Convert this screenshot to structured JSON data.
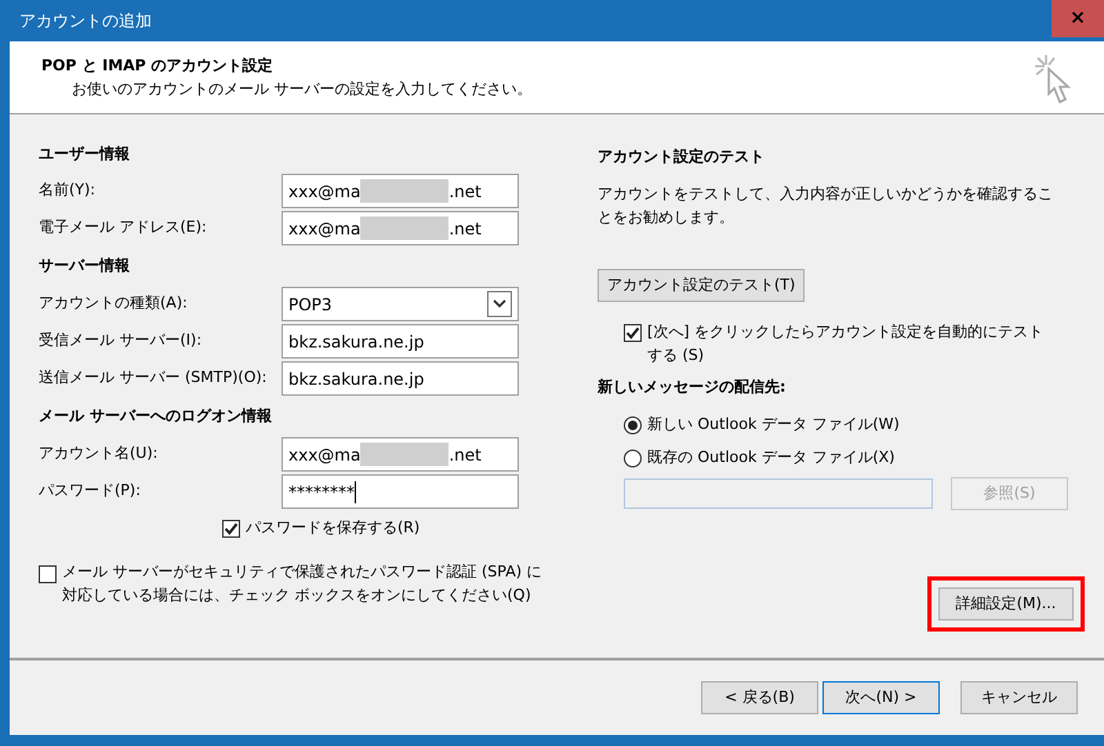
{
  "window": {
    "title": "アカウントの追加",
    "close": "×"
  },
  "header": {
    "title": "POP と IMAP のアカウント設定",
    "subtitle": "お使いのアカウントのメール サーバーの設定を入力してください。"
  },
  "left_sections": [
    {
      "heading": "ユーザー情報",
      "fields": [
        {
          "kind": "text",
          "label": "名前(Y):",
          "value": "xxx@ma",
          "value_suffix": ".net",
          "redacted": true
        },
        {
          "kind": "text",
          "label": "電子メール アドレス(E):",
          "value": "xxx@ma",
          "value_suffix": ".net",
          "redacted": true
        }
      ]
    },
    {
      "heading": "サーバー情報",
      "fields": [
        {
          "kind": "select",
          "label": "アカウントの種類(A):",
          "value": "POP3"
        },
        {
          "kind": "text",
          "label": "受信メール サーバー(I):",
          "value": "bkz.sakura.ne.jp",
          "redacted": false
        },
        {
          "kind": "text",
          "label": "送信メール サーバー (SMTP)(O):",
          "value": "bkz.sakura.ne.jp",
          "redacted": false
        }
      ]
    },
    {
      "heading": "メール サーバーへのログオン情報",
      "fields": [
        {
          "kind": "text",
          "label": "アカウント名(U):",
          "value": "xxx@ma",
          "value_suffix": ".net",
          "redacted": true
        },
        {
          "kind": "password",
          "label": "パスワード(P):",
          "value": "********",
          "focused": true
        }
      ]
    }
  ],
  "save_password": {
    "label": "パスワードを保存する(R)",
    "checked": true
  },
  "spa": {
    "label": "メール サーバーがセキュリティで保護されたパスワード認証 (SPA) に対応している場合には、チェック ボックスをオンにしてください(Q)",
    "checked": false
  },
  "test": {
    "heading": "アカウント設定のテスト",
    "description": "アカウントをテストして、入力内容が正しいかどうかを確認することをお勧めします。",
    "button": "アカウント設定のテスト(T)",
    "auto_test": {
      "label": "[次へ] をクリックしたらアカウント設定を自動的にテストする (S)",
      "checked": true
    }
  },
  "delivery": {
    "heading": "新しいメッセージの配信先:",
    "options": [
      {
        "label": "新しい Outlook データ ファイル(W)",
        "selected": true
      },
      {
        "label": "既存の Outlook データ ファイル(X)",
        "selected": false
      }
    ],
    "file_field": {
      "disabled": true
    },
    "browse_button": {
      "label": "参照(S)",
      "disabled": true
    }
  },
  "advanced_button": {
    "label": "詳細設定(M)...",
    "highlighted": true
  },
  "footer_buttons": [
    {
      "label": "< 戻る(B)",
      "default": false
    },
    {
      "label": "次へ(N) >",
      "default": true
    },
    {
      "label": "キャンセル",
      "default": false
    }
  ]
}
